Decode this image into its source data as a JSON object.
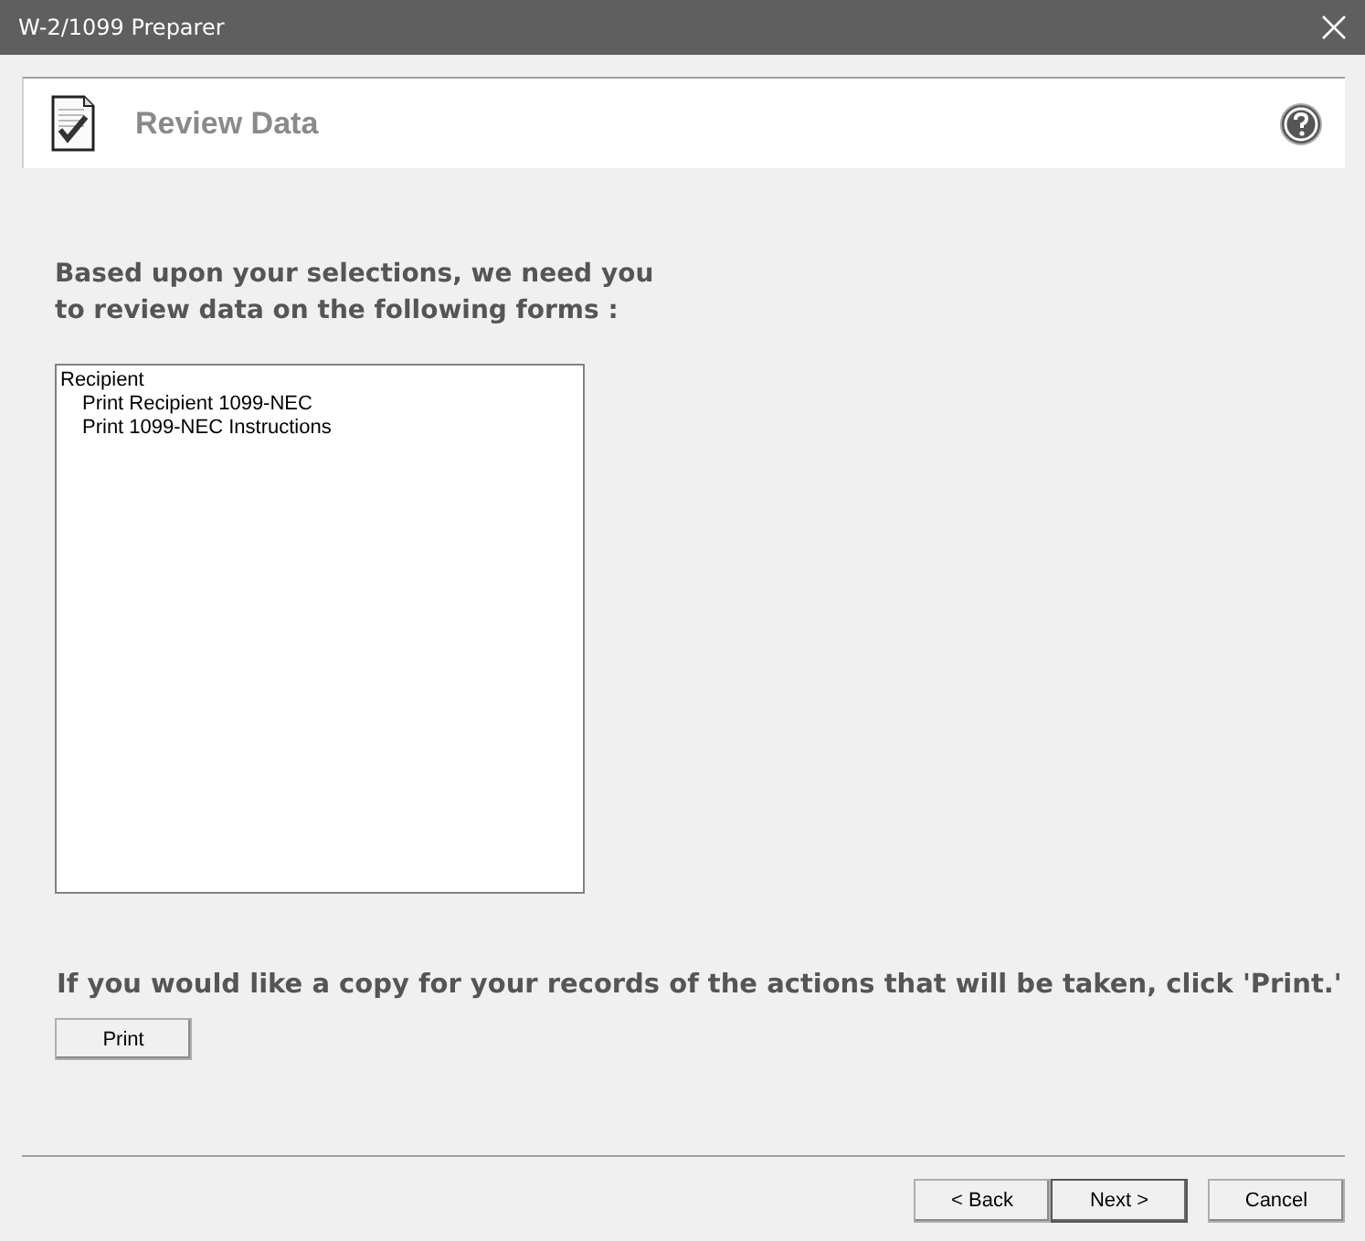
{
  "window": {
    "title": "W-2/1099 Preparer"
  },
  "header": {
    "title": "Review Data"
  },
  "instruction": [
    "Based upon your selections, we need you",
    "to review data on the following forms :"
  ],
  "forms_list": [
    {
      "label": "Recipient",
      "children": [
        {
          "label": "Print Recipient 1099-NEC"
        },
        {
          "label": "Print 1099-NEC Instructions"
        }
      ]
    }
  ],
  "print_note": "If you would like a copy for your records of the actions that will be taken, click 'Print.'",
  "print_button": "Print",
  "buttons": [
    {
      "label": "< Back",
      "default": false
    },
    {
      "label": "Next >",
      "default": true
    },
    {
      "label": "Cancel",
      "default": false
    }
  ]
}
